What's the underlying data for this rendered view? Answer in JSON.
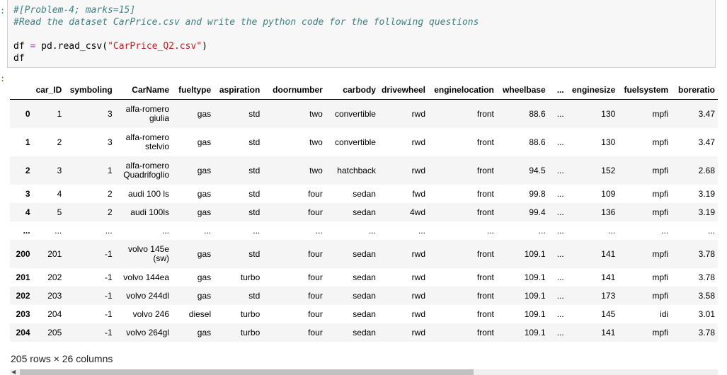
{
  "code_cell": {
    "line1": "#[Problem-4; marks=15]",
    "line2": "#Read the dataset CarPrice.csv and write the python code for the following questions",
    "line4_var": "df",
    "line4_op": "=",
    "line4_call": "pd.read_csv(",
    "line4_str": "\"CarPrice_Q2.csv\"",
    "line4_close": ")",
    "line5": "df"
  },
  "table": {
    "columns": [
      "",
      "car_ID",
      "symboling",
      "CarName",
      "fueltype",
      "aspiration",
      "doornumber",
      "carbody",
      "drivewheel",
      "enginelocation",
      "wheelbase",
      "...",
      "enginesize",
      "fuelsystem",
      "boreratio"
    ],
    "rows": [
      [
        "0",
        "1",
        "3",
        "alfa-romero giulia",
        "gas",
        "std",
        "two",
        "convertible",
        "rwd",
        "front",
        "88.6",
        "...",
        "130",
        "mpfi",
        "3.47"
      ],
      [
        "1",
        "2",
        "3",
        "alfa-romero stelvio",
        "gas",
        "std",
        "two",
        "convertible",
        "rwd",
        "front",
        "88.6",
        "...",
        "130",
        "mpfi",
        "3.47"
      ],
      [
        "2",
        "3",
        "1",
        "alfa-romero Quadrifoglio",
        "gas",
        "std",
        "two",
        "hatchback",
        "rwd",
        "front",
        "94.5",
        "...",
        "152",
        "mpfi",
        "2.68"
      ],
      [
        "3",
        "4",
        "2",
        "audi 100 ls",
        "gas",
        "std",
        "four",
        "sedan",
        "fwd",
        "front",
        "99.8",
        "...",
        "109",
        "mpfi",
        "3.19"
      ],
      [
        "4",
        "5",
        "2",
        "audi 100ls",
        "gas",
        "std",
        "four",
        "sedan",
        "4wd",
        "front",
        "99.4",
        "...",
        "136",
        "mpfi",
        "3.19"
      ],
      [
        "...",
        "...",
        "...",
        "...",
        "...",
        "...",
        "...",
        "...",
        "...",
        "...",
        "...",
        "...",
        "...",
        "...",
        "..."
      ],
      [
        "200",
        "201",
        "-1",
        "volvo 145e (sw)",
        "gas",
        "std",
        "four",
        "sedan",
        "rwd",
        "front",
        "109.1",
        "...",
        "141",
        "mpfi",
        "3.78"
      ],
      [
        "201",
        "202",
        "-1",
        "volvo 144ea",
        "gas",
        "turbo",
        "four",
        "sedan",
        "rwd",
        "front",
        "109.1",
        "...",
        "141",
        "mpfi",
        "3.78"
      ],
      [
        "202",
        "203",
        "-1",
        "volvo 244dl",
        "gas",
        "std",
        "four",
        "sedan",
        "rwd",
        "front",
        "109.1",
        "...",
        "173",
        "mpfi",
        "3.58"
      ],
      [
        "203",
        "204",
        "-1",
        "volvo 246",
        "diesel",
        "turbo",
        "four",
        "sedan",
        "rwd",
        "front",
        "109.1",
        "...",
        "145",
        "idi",
        "3.01"
      ],
      [
        "204",
        "205",
        "-1",
        "volvo 264gl",
        "gas",
        "turbo",
        "four",
        "sedan",
        "rwd",
        "front",
        "109.1",
        "...",
        "141",
        "mpfi",
        "3.78"
      ]
    ]
  },
  "shape_text": "205 rows × 26 columns",
  "scrollbar": {
    "thumb_fraction": 0.65
  }
}
